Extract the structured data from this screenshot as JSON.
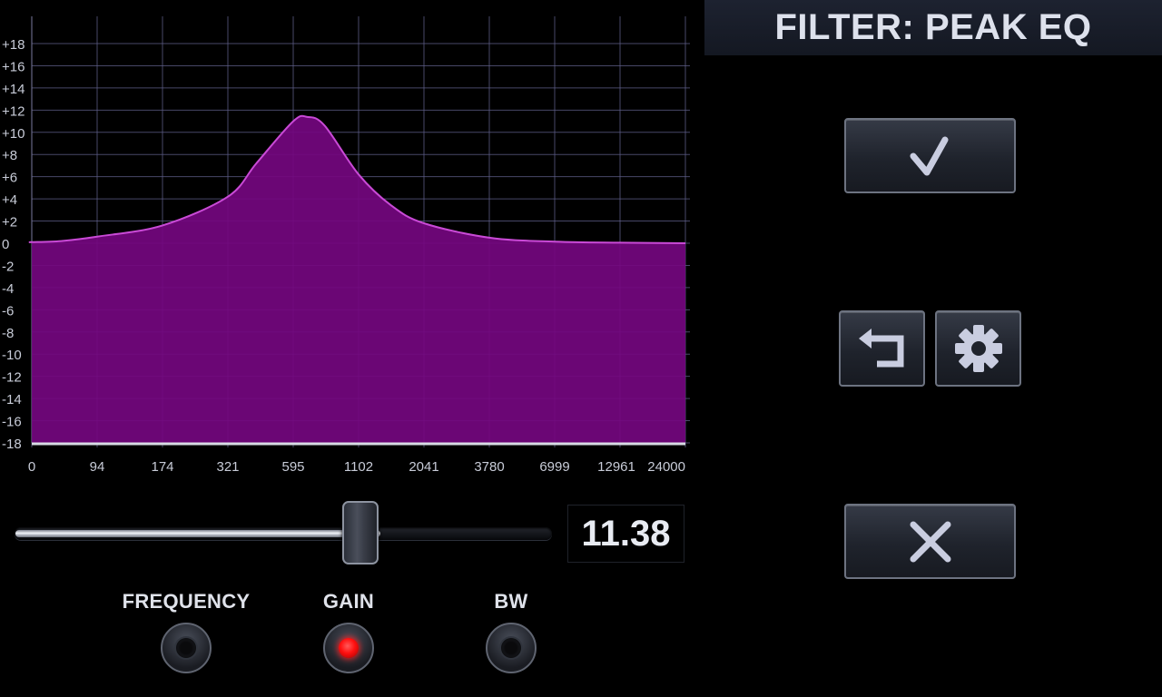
{
  "title": "FILTER: PEAK EQ",
  "colors": {
    "curve_fill": "#74067f",
    "curve_line": "#c94ad6",
    "grid": "#5f5f8a",
    "active_indicator": "#ff1a1a"
  },
  "chart_data": {
    "type": "area",
    "y_tick_labels": [
      "+18",
      "+16",
      "+14",
      "+12",
      "+10",
      "+8",
      "+6",
      "+4",
      "+2",
      "0",
      "-2",
      "-4",
      "-6",
      "-8",
      "-10",
      "-12",
      "-14",
      "-16",
      "-18"
    ],
    "x_tick_labels": [
      "0",
      "94",
      "174",
      "321",
      "595",
      "1102",
      "2041",
      "3780",
      "6999",
      "12961",
      "24000"
    ],
    "ylim": [
      -18,
      18
    ],
    "grid": true,
    "x_scale": "log",
    "x": [
      20,
      40,
      94,
      174,
      321,
      420,
      595,
      680,
      800,
      1102,
      1500,
      2041,
      3780,
      6999,
      12961,
      24000
    ],
    "y": [
      0.1,
      0.2,
      0.6,
      1.6,
      4.2,
      7.2,
      11.0,
      11.38,
      10.6,
      6.2,
      3.4,
      1.8,
      0.5,
      0.15,
      0.05,
      0.0
    ]
  },
  "slider": {
    "value": "11.38",
    "fraction": 0.62
  },
  "buttons": {
    "confirm": "confirm",
    "undo": "undo",
    "settings": "settings",
    "cancel": "cancel"
  },
  "params": [
    {
      "label": "FREQUENCY",
      "active": false
    },
    {
      "label": "GAIN",
      "active": true
    },
    {
      "label": "BW",
      "active": false
    }
  ]
}
